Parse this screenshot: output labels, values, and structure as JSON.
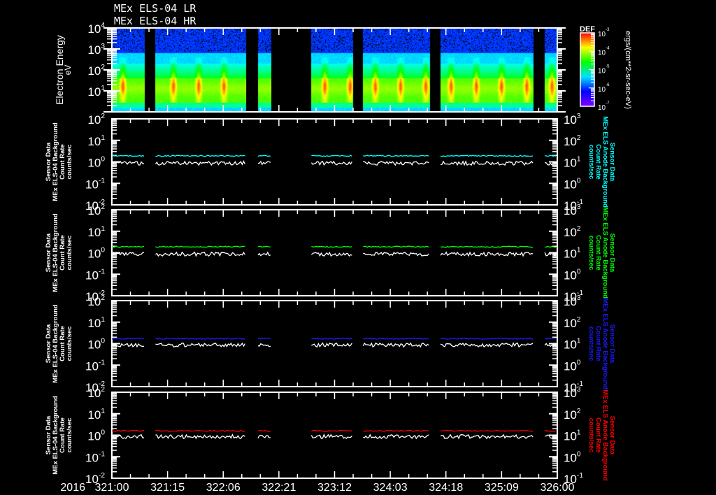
{
  "header": {
    "titles": [
      "MEx ELS-04 LR",
      "MEx ELS-04 HR"
    ]
  },
  "xaxis": {
    "year": "2016",
    "range_doy": [
      321,
      326
    ],
    "tick_labels": [
      "321:00",
      "321:15",
      "322:06",
      "322:21",
      "323:12",
      "324:03",
      "324:18",
      "325:09",
      "326:00"
    ]
  },
  "chart_data": [
    {
      "type": "heatmap",
      "ylabel": "Electron Energy",
      "yunit": "eV",
      "yscale": "log",
      "ylim": [
        1,
        10000
      ],
      "yticks": [
        {
          "base": "10",
          "exp": "4"
        },
        {
          "base": "10",
          "exp": "3"
        },
        {
          "base": "10",
          "exp": "2"
        },
        {
          "base": "10",
          "exp": "1"
        }
      ],
      "colorbar": {
        "label": "DEF",
        "units": "ergs/(cm**2-sr-sec-eV)",
        "scale": "log",
        "range": [
          1e-07,
          0.001
        ],
        "colormap": "rainbow (purple-blue-cyan-green-yellow-red)",
        "ticks": [
          {
            "base": "10",
            "exp": "-3"
          },
          {
            "base": "10",
            "exp": "-4"
          },
          {
            "base": "10",
            "exp": "-5"
          },
          {
            "base": "10",
            "exp": "-6"
          },
          {
            "base": "10",
            "exp": "-7"
          }
        ]
      },
      "data_segments_doy": [
        [
          321.0,
          321.37
        ],
        [
          321.49,
          322.51
        ],
        [
          322.64,
          322.79
        ],
        [
          323.24,
          323.71
        ],
        [
          323.82,
          324.57
        ],
        [
          324.69,
          325.73
        ],
        [
          325.86,
          326.0
        ]
      ],
      "peak_flux_energy_eV": 15
    },
    {
      "type": "line",
      "yscale": "log",
      "ylim_left": [
        0.01,
        100
      ],
      "ylim_right": [
        0.1,
        1000
      ],
      "yticks_left": [
        {
          "base": "10",
          "exp": "2"
        },
        {
          "base": "10",
          "exp": "1"
        },
        {
          "base": "10",
          "exp": "0"
        },
        {
          "base": "10",
          "exp": "-1"
        },
        {
          "base": "10",
          "exp": "-2"
        }
      ],
      "yticks_right": [
        {
          "base": "10",
          "exp": "3"
        },
        {
          "base": "10",
          "exp": "2"
        },
        {
          "base": "10",
          "exp": "1"
        },
        {
          "base": "10",
          "exp": "0"
        },
        {
          "base": "10",
          "exp": "-1"
        }
      ],
      "ylabel_left": [
        "Sensor Data",
        "MEx ELS-04 Background",
        "Count Rate",
        "counts/sec"
      ],
      "ylabel_right": [
        "Sensor Data",
        "MEx ELS Anode Background",
        "Count Rate",
        "counts/sec"
      ],
      "series": [
        {
          "name": "Sensor Data",
          "color": "#ffffff",
          "typical_value": 0.9
        },
        {
          "name": "MEx ELS Anode Background",
          "color": "#00ffff",
          "typical_value": 1.9
        }
      ]
    },
    {
      "type": "line",
      "yscale": "log",
      "ylim_left": [
        0.01,
        100
      ],
      "ylim_right": [
        0.1,
        1000
      ],
      "yticks_left": [
        {
          "base": "10",
          "exp": "2"
        },
        {
          "base": "10",
          "exp": "1"
        },
        {
          "base": "10",
          "exp": "0"
        },
        {
          "base": "10",
          "exp": "-1"
        },
        {
          "base": "10",
          "exp": "-2"
        }
      ],
      "yticks_right": [
        {
          "base": "10",
          "exp": "3"
        },
        {
          "base": "10",
          "exp": "2"
        },
        {
          "base": "10",
          "exp": "1"
        },
        {
          "base": "10",
          "exp": "0"
        },
        {
          "base": "10",
          "exp": "-1"
        }
      ],
      "ylabel_left": [
        "Sensor Data",
        "MEx ELS-04 Background",
        "Count Rate",
        "counts/sec"
      ],
      "ylabel_right": [
        "Sensor Data",
        "MEx ELS Anode Background",
        "Count Rate",
        "counts/sec"
      ],
      "series": [
        {
          "name": "Sensor Data",
          "color": "#ffffff",
          "typical_value": 0.9
        },
        {
          "name": "MEx ELS Anode Background",
          "color": "#00ff00",
          "typical_value": 1.9
        }
      ]
    },
    {
      "type": "line",
      "yscale": "log",
      "ylim_left": [
        0.01,
        100
      ],
      "ylim_right": [
        0.1,
        1000
      ],
      "yticks_left": [
        {
          "base": "10",
          "exp": "2"
        },
        {
          "base": "10",
          "exp": "1"
        },
        {
          "base": "10",
          "exp": "0"
        },
        {
          "base": "10",
          "exp": "-1"
        },
        {
          "base": "10",
          "exp": "-2"
        }
      ],
      "yticks_right": [
        {
          "base": "10",
          "exp": "3"
        },
        {
          "base": "10",
          "exp": "2"
        },
        {
          "base": "10",
          "exp": "1"
        },
        {
          "base": "10",
          "exp": "0"
        },
        {
          "base": "10",
          "exp": "-1"
        }
      ],
      "ylabel_left": [
        "Sensor Data",
        "MEx ELS-04 Background",
        "Count Rate",
        "counts/sec"
      ],
      "ylabel_right": [
        "Sensor Data",
        "MEx ELS Anode Background",
        "Count Rate",
        "counts/sec"
      ],
      "series": [
        {
          "name": "Sensor Data",
          "color": "#ffffff",
          "typical_value": 0.9
        },
        {
          "name": "MEx ELS Anode Background",
          "color": "#1a1aff",
          "typical_value": 1.7
        }
      ]
    },
    {
      "type": "line",
      "yscale": "log",
      "ylim_left": [
        0.01,
        100
      ],
      "ylim_right": [
        0.1,
        1000
      ],
      "yticks_left": [
        {
          "base": "10",
          "exp": "2"
        },
        {
          "base": "10",
          "exp": "1"
        },
        {
          "base": "10",
          "exp": "0"
        },
        {
          "base": "10",
          "exp": "-1"
        },
        {
          "base": "10",
          "exp": "-2"
        }
      ],
      "yticks_right": [
        {
          "base": "10",
          "exp": "3"
        },
        {
          "base": "10",
          "exp": "2"
        },
        {
          "base": "10",
          "exp": "1"
        },
        {
          "base": "10",
          "exp": "0"
        },
        {
          "base": "10",
          "exp": "-1"
        }
      ],
      "ylabel_left": [
        "Sensor Data",
        "MEx ELS-04 Background",
        "Count Rate",
        "counts/sec"
      ],
      "ylabel_right": [
        "Sensor Data",
        "MEx ELS Anode Background",
        "Count Rate",
        "counts/sec"
      ],
      "series": [
        {
          "name": "Sensor Data",
          "color": "#ffffff",
          "typical_value": 0.9
        },
        {
          "name": "MEx ELS Anode Background",
          "color": "#ff0000",
          "typical_value": 1.6
        }
      ]
    }
  ]
}
